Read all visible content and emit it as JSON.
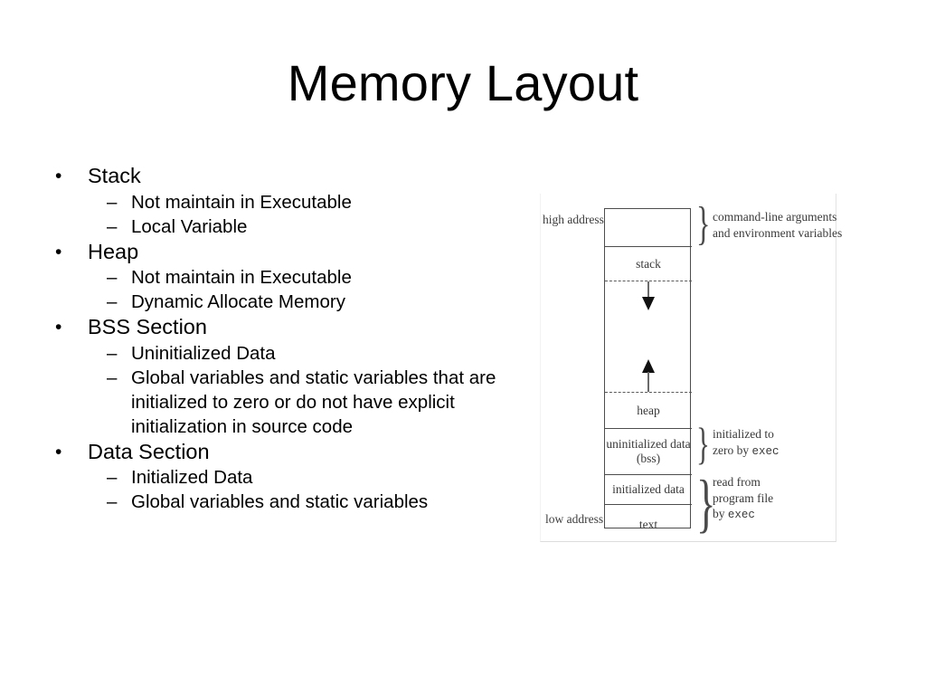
{
  "slide": {
    "title": "Memory Layout"
  },
  "bullets": [
    {
      "label": "Stack",
      "sub": [
        {
          "text": "Not maintain in Executable"
        },
        {
          "text": "Local Variable"
        }
      ]
    },
    {
      "label": "Heap",
      "sub": [
        {
          "text": "Not maintain in Executable"
        },
        {
          "text": "Dynamic Allocate Memory"
        }
      ]
    },
    {
      "label": "BSS Section",
      "sub": [
        {
          "text": "Uninitialized Data"
        },
        {
          "text": "Global variables and static variables that are initialized to zero or do not have explicit initialization in source code"
        }
      ]
    },
    {
      "label": "Data Section",
      "sub": [
        {
          "text": "Initialized Data"
        },
        {
          "text": "Global variables and static variables"
        }
      ]
    }
  ],
  "markers": {
    "level1": "•",
    "level2": "–"
  },
  "figure": {
    "address_high": "high address",
    "address_low": "low address",
    "segments": {
      "args_env": "",
      "stack": "stack",
      "heap": "heap",
      "bss_line1": "uninitialized data",
      "bss_line2": "(bss)",
      "initialized_data": "initialized data",
      "text": "text"
    },
    "annotations": {
      "args_env_line1": "command-line arguments",
      "args_env_line2": "and environment variables",
      "bss_line1": "initialized to",
      "bss_line2_a": "zero by ",
      "bss_line2_mono": "exec",
      "data_line1": "read from",
      "data_line2": "program file",
      "data_line3_a": "by ",
      "data_line3_mono": "exec"
    },
    "brace_glyph": "}"
  },
  "colors": {
    "background": "#ffffff",
    "text": "#000000",
    "figure_line": "#4d4d4d",
    "figure_text": "#3a3a3a"
  }
}
